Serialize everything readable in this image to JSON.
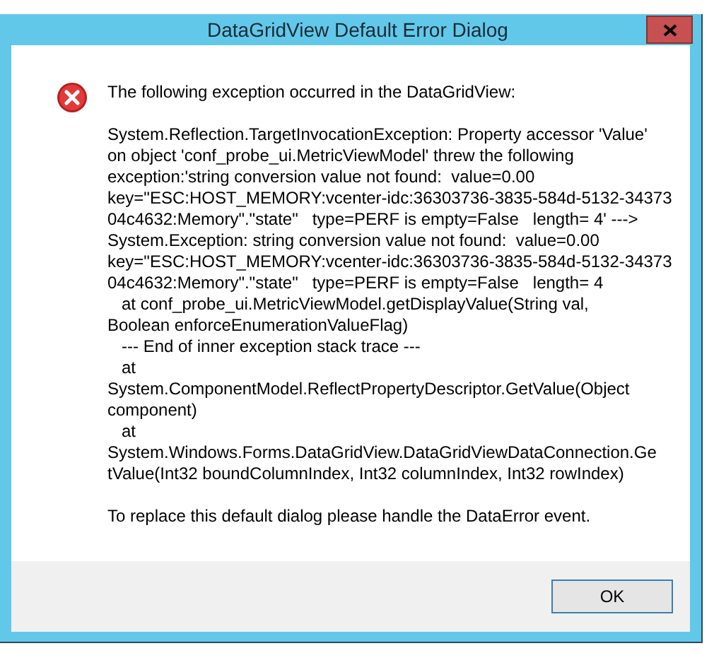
{
  "window": {
    "title": "DataGridView Default Error Dialog"
  },
  "heading": "The following exception occurred in the DataGridView:",
  "details": [
    "System.Reflection.TargetInvocationException: Property accessor 'Value'",
    "on object 'conf_probe_ui.MetricViewModel' threw the following",
    "exception:'string conversion value not found:  value=0.00",
    "key=\"ESC:HOST_MEMORY:vcenter-idc:36303736-3835-584d-5132-34373",
    "04c4632:Memory\".\"state\"   type=PERF is empty=False   length= 4' --->",
    "System.Exception: string conversion value not found:  value=0.00",
    "key=\"ESC:HOST_MEMORY:vcenter-idc:36303736-3835-584d-5132-34373",
    "04c4632:Memory\".\"state\"   type=PERF is empty=False   length= 4",
    "   at conf_probe_ui.MetricViewModel.getDisplayValue(String val,",
    "Boolean enforceEnumerationValueFlag)",
    "   --- End of inner exception stack trace ---",
    "   at",
    "System.ComponentModel.ReflectPropertyDescriptor.GetValue(Object",
    "component)",
    "   at",
    "System.Windows.Forms.DataGridView.DataGridViewDataConnection.Ge",
    "tValue(Int32 boundColumnIndex, Int32 columnIndex, Int32 rowIndex)"
  ],
  "footer": "To replace this default dialog please handle the DataError event.",
  "buttons": [
    "OK"
  ]
}
